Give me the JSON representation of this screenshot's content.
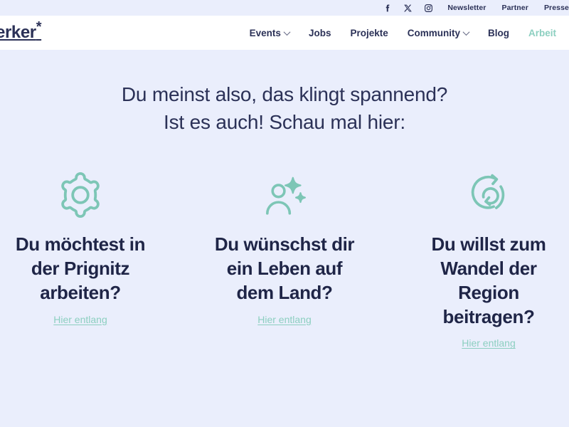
{
  "utility_bar": {
    "socials": [
      {
        "name": "facebook-icon",
        "label": "Facebook"
      },
      {
        "name": "x-twitter-icon",
        "label": "X"
      },
      {
        "name": "instagram-icon",
        "label": "Instagram"
      }
    ],
    "links": [
      {
        "label": "Newsletter"
      },
      {
        "label": "Partner"
      },
      {
        "label": "Presse"
      }
    ]
  },
  "header": {
    "brand": "erker",
    "brand_star": "*",
    "nav": [
      {
        "label": "Events",
        "has_dropdown": true,
        "active": false
      },
      {
        "label": "Jobs",
        "has_dropdown": false,
        "active": false
      },
      {
        "label": "Projekte",
        "has_dropdown": false,
        "active": false
      },
      {
        "label": "Community",
        "has_dropdown": true,
        "active": false
      },
      {
        "label": "Blog",
        "has_dropdown": false,
        "active": false
      },
      {
        "label": "Arbeit",
        "has_dropdown": false,
        "active": true
      }
    ]
  },
  "hero": {
    "line1": "Du meinst also, das klingt spannend?",
    "line2": "Ist es auch! Schau mal hier:"
  },
  "cards": [
    {
      "icon": "gear-icon",
      "title_lines": [
        "Du möchtest in",
        "der Prignitz",
        "arbeiten?"
      ],
      "link_label": "Hier entlang"
    },
    {
      "icon": "person-sparkle-icon",
      "title_lines": [
        "Du wünschst dir",
        "ein Leben auf",
        "dem Land?"
      ],
      "link_label": "Hier entlang"
    },
    {
      "icon": "refresh-cycle-icon",
      "title_lines": [
        "Du willst zum",
        "Wandel der",
        "Region",
        "beitragen?"
      ],
      "link_label": "Hier entlang"
    }
  ],
  "colors": {
    "page_background": "#eaeefc",
    "header_background": "#ffffff",
    "text_dark": "#2b3157",
    "accent_mint": "#8ccfc0",
    "icon_mint": "#7dc6b6"
  }
}
